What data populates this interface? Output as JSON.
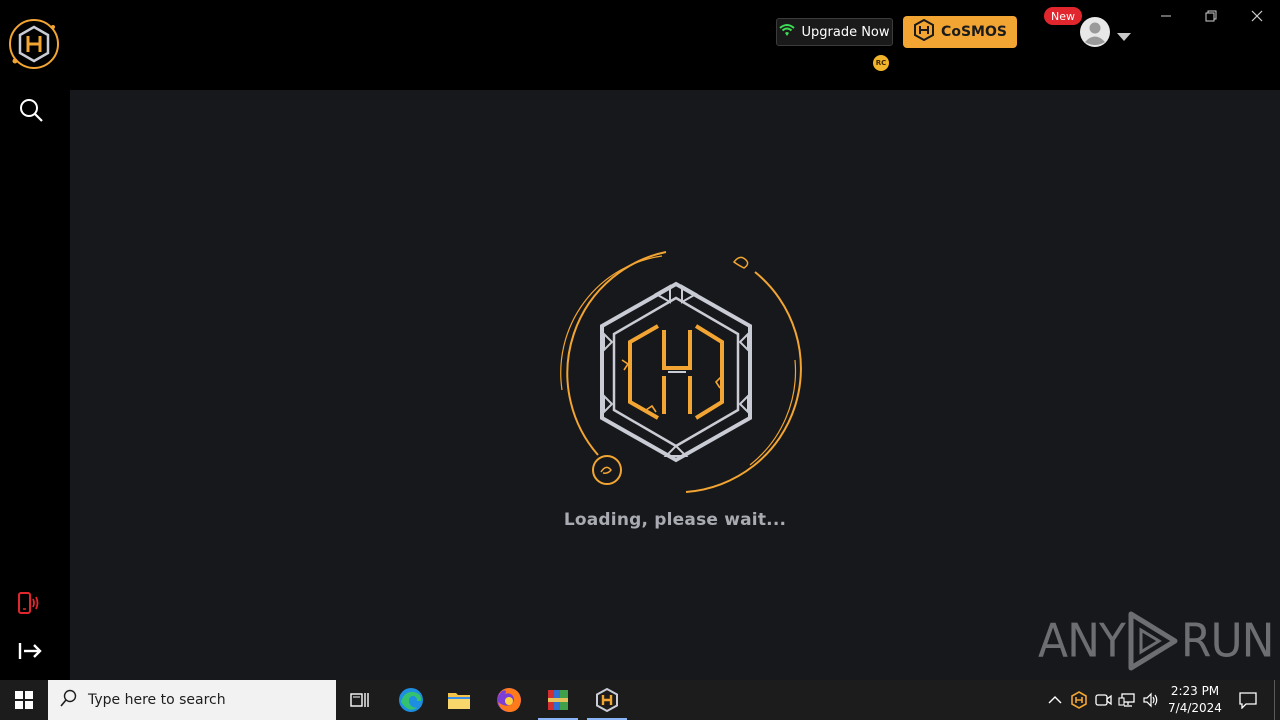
{
  "header": {
    "upgrade_label": "Upgrade Now",
    "cosmos_label": "CoSMOS",
    "rc_badge": "RC",
    "new_badge": "New"
  },
  "main": {
    "loading_text": "Loading, please wait..."
  },
  "watermark": {
    "text_left": "ANY",
    "text_right": "RUN"
  },
  "taskbar": {
    "search_placeholder": "Type here to search",
    "time": "2:23 PM",
    "date": "7/4/2024"
  },
  "colors": {
    "accent_orange": "#f2a532",
    "upgrade_green": "#3ddc54",
    "alert_red": "#e2262d",
    "main_bg": "#17181b"
  },
  "icons": {
    "sidebar": [
      "search-icon",
      "phone-vibrate-icon",
      "logout-icon"
    ],
    "taskbar": [
      "windows-start-icon",
      "search-icon",
      "task-view-icon",
      "edge-icon",
      "file-explorer-icon",
      "firefox-icon",
      "winrar-icon",
      "app-logo-icon"
    ],
    "tray": [
      "chevron-up-icon",
      "app-tray-icon",
      "meet-now-icon",
      "network-icon",
      "volume-icon",
      "notification-icon"
    ]
  }
}
